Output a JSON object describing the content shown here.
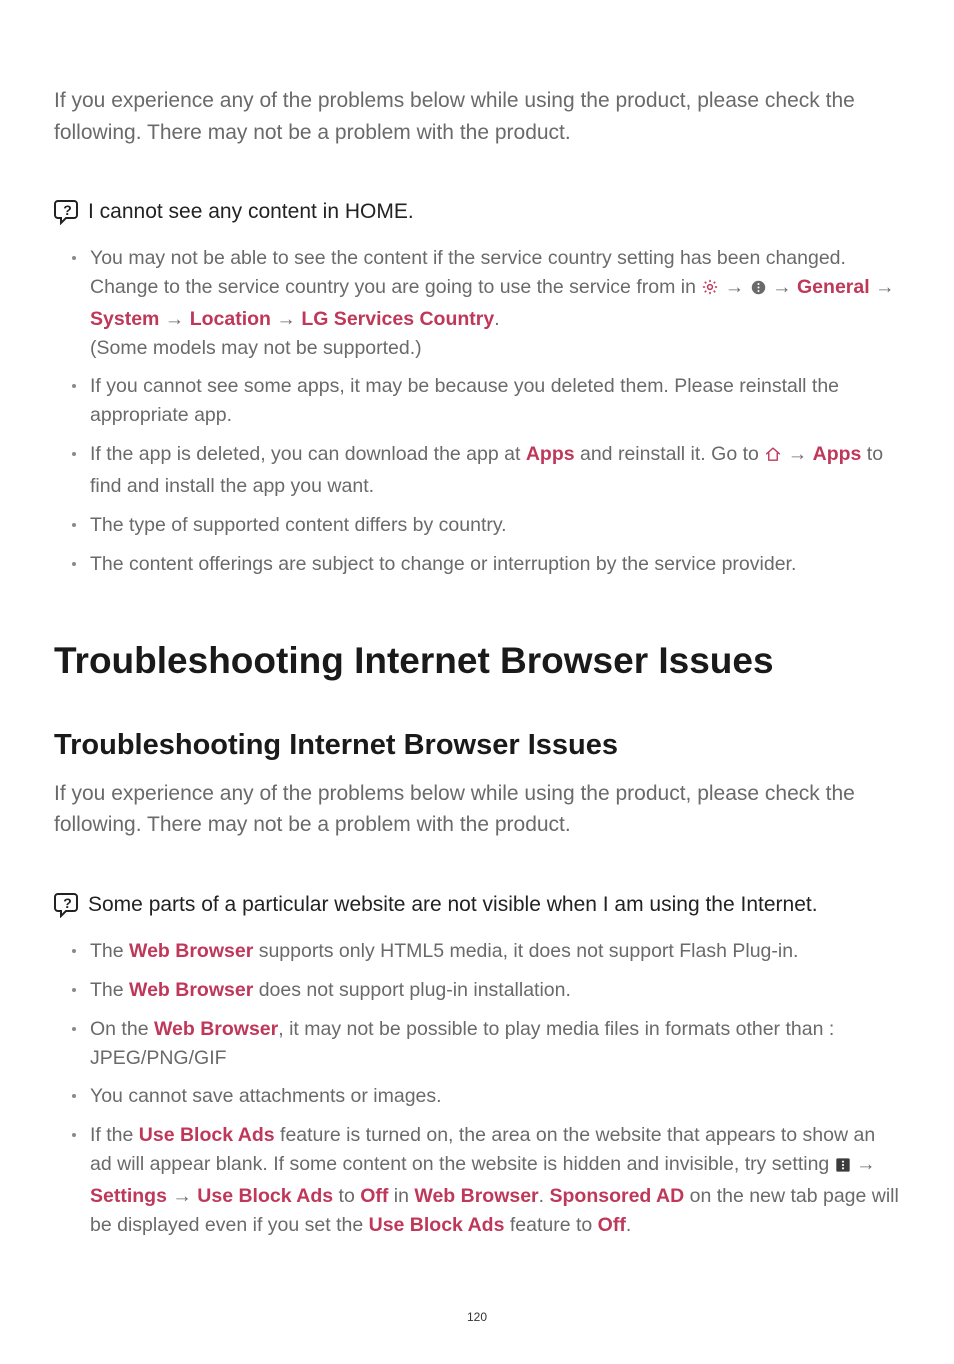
{
  "intro1": "If you experience any of the problems below while using the product, please check the following. There may not be a problem with the product.",
  "q1": {
    "title": "I cannot see any content in HOME.",
    "items": [
      {
        "pre": "You may not be able to see the content if the service country setting has been changed. Change to the service country you are going to use the service from in ",
        "path": [
          "General",
          "System",
          "Location",
          "LG Services Country"
        ],
        "post": ".\n(Some models may not be supported.)"
      },
      {
        "text": "If you cannot see some apps, it may be because you deleted them. Please reinstall the appropriate app."
      },
      {
        "pre": "If the app is deleted, you can download the app at ",
        "link1": "Apps",
        "mid": " and reinstall it. Go to ",
        "link2": "Apps",
        "post": " to find and install the app you want."
      },
      {
        "text": "The type of supported content differs by country."
      },
      {
        "text": "The content offerings are subject to change or interruption by the service provider."
      }
    ]
  },
  "h1": "Troubleshooting Internet Browser Issues",
  "h2": "Troubleshooting Internet Browser Issues",
  "intro2": "If you experience any of the problems below while using the product, please check the following. There may not be a problem with the product.",
  "q2": {
    "title": "Some parts of a particular website are not visible when I am using the Internet.",
    "items": [
      {
        "pre": "The ",
        "link1": "Web Browser",
        "post": " supports only HTML5 media, it does not support Flash Plug-in."
      },
      {
        "pre": "The ",
        "link1": "Web Browser",
        "post": " does not support plug-in installation."
      },
      {
        "pre": "On the ",
        "link1": "Web Browser",
        "post": ", it may not be possible to play media files in formats other than : JPEG/PNG/GIF"
      },
      {
        "text": "You cannot save attachments or images."
      },
      {
        "pre": "If the ",
        "link1": "Use Block Ads",
        "mid1": " feature is turned on, the area on the website that appears to show an ad will appear blank. If some content on the website is hidden and invisible, try setting ",
        "path": [
          "Settings",
          "Use Block Ads"
        ],
        "mid2": " to ",
        "link2": "Off",
        "mid3": " in ",
        "link3": "Web Browser",
        "mid4": ". ",
        "link4": "Sponsored AD",
        "mid5": " on the new tab page will be displayed even if you set the ",
        "link5": "Use Block Ads",
        "mid6": " feature to ",
        "link6": "Off",
        "post": "."
      }
    ]
  },
  "pagenum": "120",
  "icons": {
    "question": "question-icon",
    "gear": "gear-icon",
    "dots": "dots-icon",
    "home": "home-icon",
    "menu": "menu-icon"
  }
}
